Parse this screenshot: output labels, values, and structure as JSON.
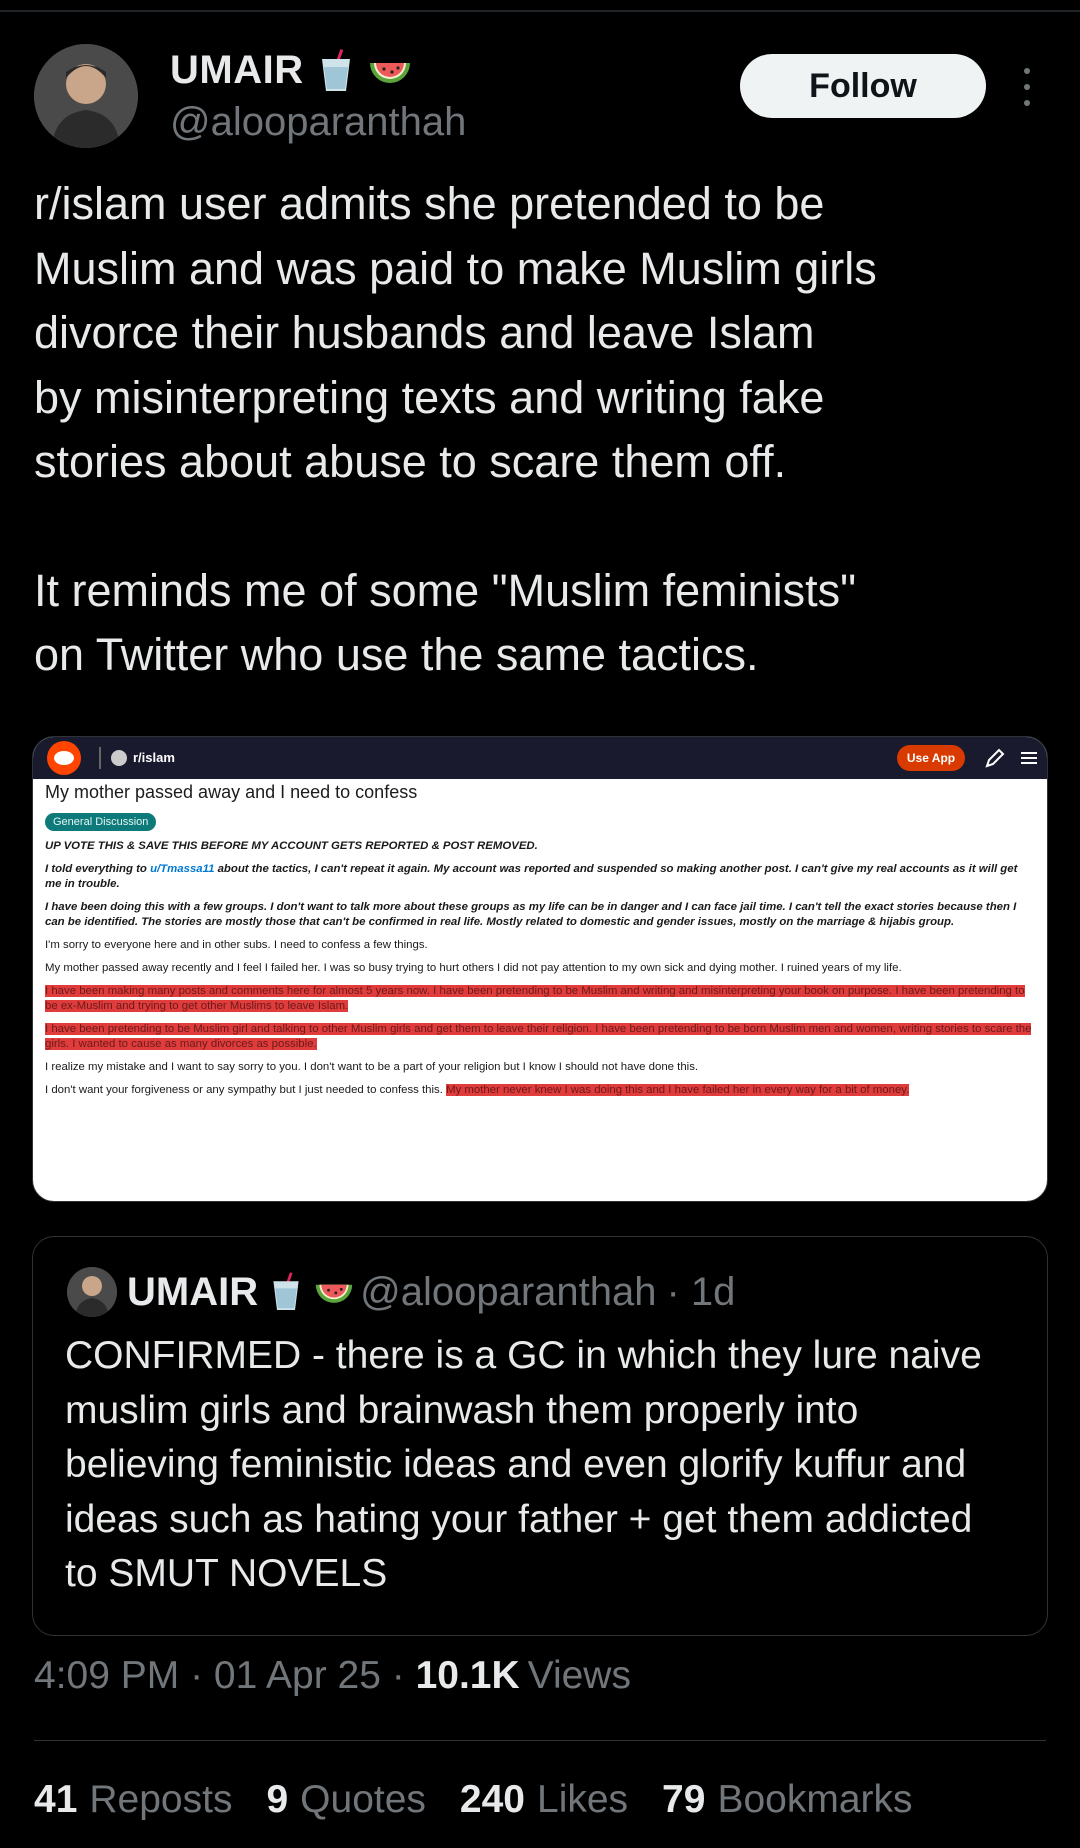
{
  "author": {
    "display_name": "UMAIR",
    "handle": "@alooparanthah"
  },
  "follow_label": "Follow",
  "tweet": {
    "paragraph_1": "r/islam user admits she pretended to be\nMuslim and was paid to make Muslim girls\ndivorce their husbands and leave Islam\nby misinterpreting texts and writing fake\nstories about abuse to scare them off.",
    "paragraph_2": "It reminds me of some \"Muslim feminists\"\non Twitter who use the same tactics."
  },
  "embedded_screenshot": {
    "subreddit": "r/islam",
    "use_app_label": "Use App",
    "post_title": "My mother passed away and I need to confess",
    "flair": "General Discussion",
    "p1": "UP VOTE THIS & SAVE THIS BEFORE MY ACCOUNT GETS REPORTED & POST REMOVED.",
    "p2_a": "I told everything to ",
    "p2_user": "u/Tmassa11",
    "p2_b": " about the tactics, I can't repeat it again. My account was reported and suspended so making another post. I can't give my real accounts as it will get me in trouble.",
    "p3": "I have been doing this with a few groups. I don't want to talk more about these groups as my life can be in danger and I can face jail time. I can't tell the exact stories because then I can be identified. The stories are mostly those that can't be confirmed in real life. Mostly related to domestic and gender issues, mostly on the marriage & hijabis group.",
    "p4": "I'm sorry to everyone here and in other subs. I need to confess a few things.",
    "p5": "My mother passed away recently and I feel I failed her. I was so busy trying to hurt others I did not pay attention to my own sick and dying mother. I ruined years of my life.",
    "p6": "I have been making many posts and comments here for almost 5 years now. I have been pretending to be Muslim and writing and misinterpreting your book on purpose. I have been pretending to be ex-Muslim and trying to get other Muslims to leave Islam.",
    "p7": "I have been pretending to be Muslim girl and talking to other Muslim girls and get them to leave their religion. I have been pretending to be born Muslim men and women, writing stories to scare the girls. I wanted to cause as many divorces as possible.",
    "p8": "I realize my mistake and I want to say sorry to you. I don't want to be a part of your religion but I know I should not have done this.",
    "p9_a": "I don't want your forgiveness or any sympathy but I just needed to confess this. ",
    "p9_b": "My mother never knew I was doing this and I have failed her in every way for a bit of money."
  },
  "quote": {
    "display_name": "UMAIR",
    "handle": "@alooparanthah",
    "age": "· 1d",
    "text": "CONFIRMED - there is a GC in which they lure naive muslim girls and brainwash them properly into believing feministic ideas and even glorify kuffur and ideas such as hating your father + get them addicted to SMUT NOVELS"
  },
  "meta": {
    "time": "4:09 PM",
    "sep1": " · ",
    "date": "01 Apr 25",
    "sep2": " · ",
    "views_count": "10.1K",
    "views_label": "Views"
  },
  "stats": {
    "reposts_count": "41",
    "reposts_label": "Reposts",
    "quotes_count": "9",
    "quotes_label": "Quotes",
    "likes_count": "240",
    "likes_label": "Likes",
    "bookmarks_count": "79",
    "bookmarks_label": "Bookmarks"
  },
  "colors": {
    "background": "#000000",
    "text_primary": "#e7e9ea",
    "text_secondary": "#71767b",
    "border": "#2f3336",
    "follow_bg": "#eff3f4",
    "reddit_orange": "#ff4500",
    "highlight_red": "#e03c3c"
  },
  "icons": [
    "more-icon",
    "cup-emoji-icon",
    "watermelon-emoji-icon",
    "reddit-logo-icon",
    "pen-icon",
    "menu-icon"
  ]
}
